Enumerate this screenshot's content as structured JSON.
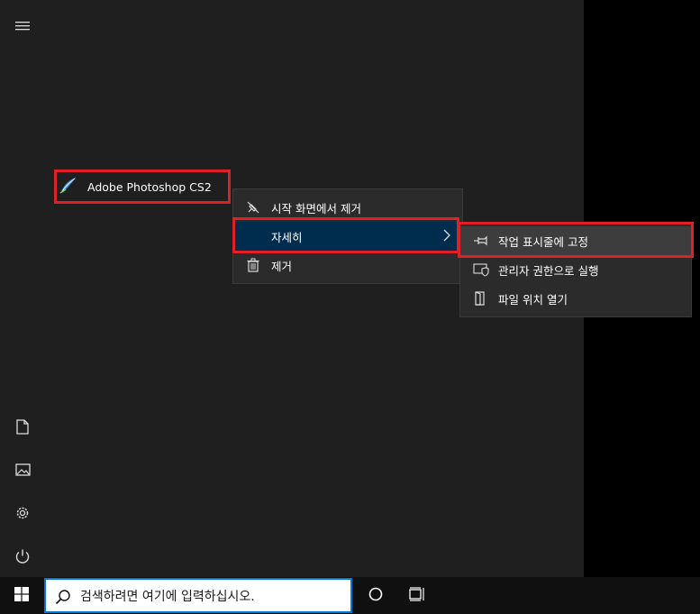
{
  "start": {
    "tile": {
      "label": "Adobe Photoshop CS2"
    },
    "rail_icons": [
      "hamburger-menu-icon",
      "document-icon",
      "pictures-icon",
      "settings-gear-icon",
      "power-icon"
    ]
  },
  "context_menu": {
    "items": [
      {
        "label": "시작 화면에서 제거",
        "icon": "unpin-icon"
      },
      {
        "label": "자세히",
        "icon": "none",
        "has_submenu": true
      },
      {
        "label": "제거",
        "icon": "trash-icon"
      }
    ]
  },
  "submenu": {
    "items": [
      {
        "label": "작업 표시줄에 고정",
        "icon": "pin-icon"
      },
      {
        "label": "관리자 권한으로 실행",
        "icon": "shield-icon"
      },
      {
        "label": "파일 위치 열기",
        "icon": "folder-icon"
      }
    ]
  },
  "taskbar": {
    "search_placeholder": "검색하려면 여기에 입력하십시오."
  },
  "colors": {
    "highlight_red": "#e01f26",
    "hover_blue": "#002d4d",
    "accent_blue": "#0078d7"
  }
}
